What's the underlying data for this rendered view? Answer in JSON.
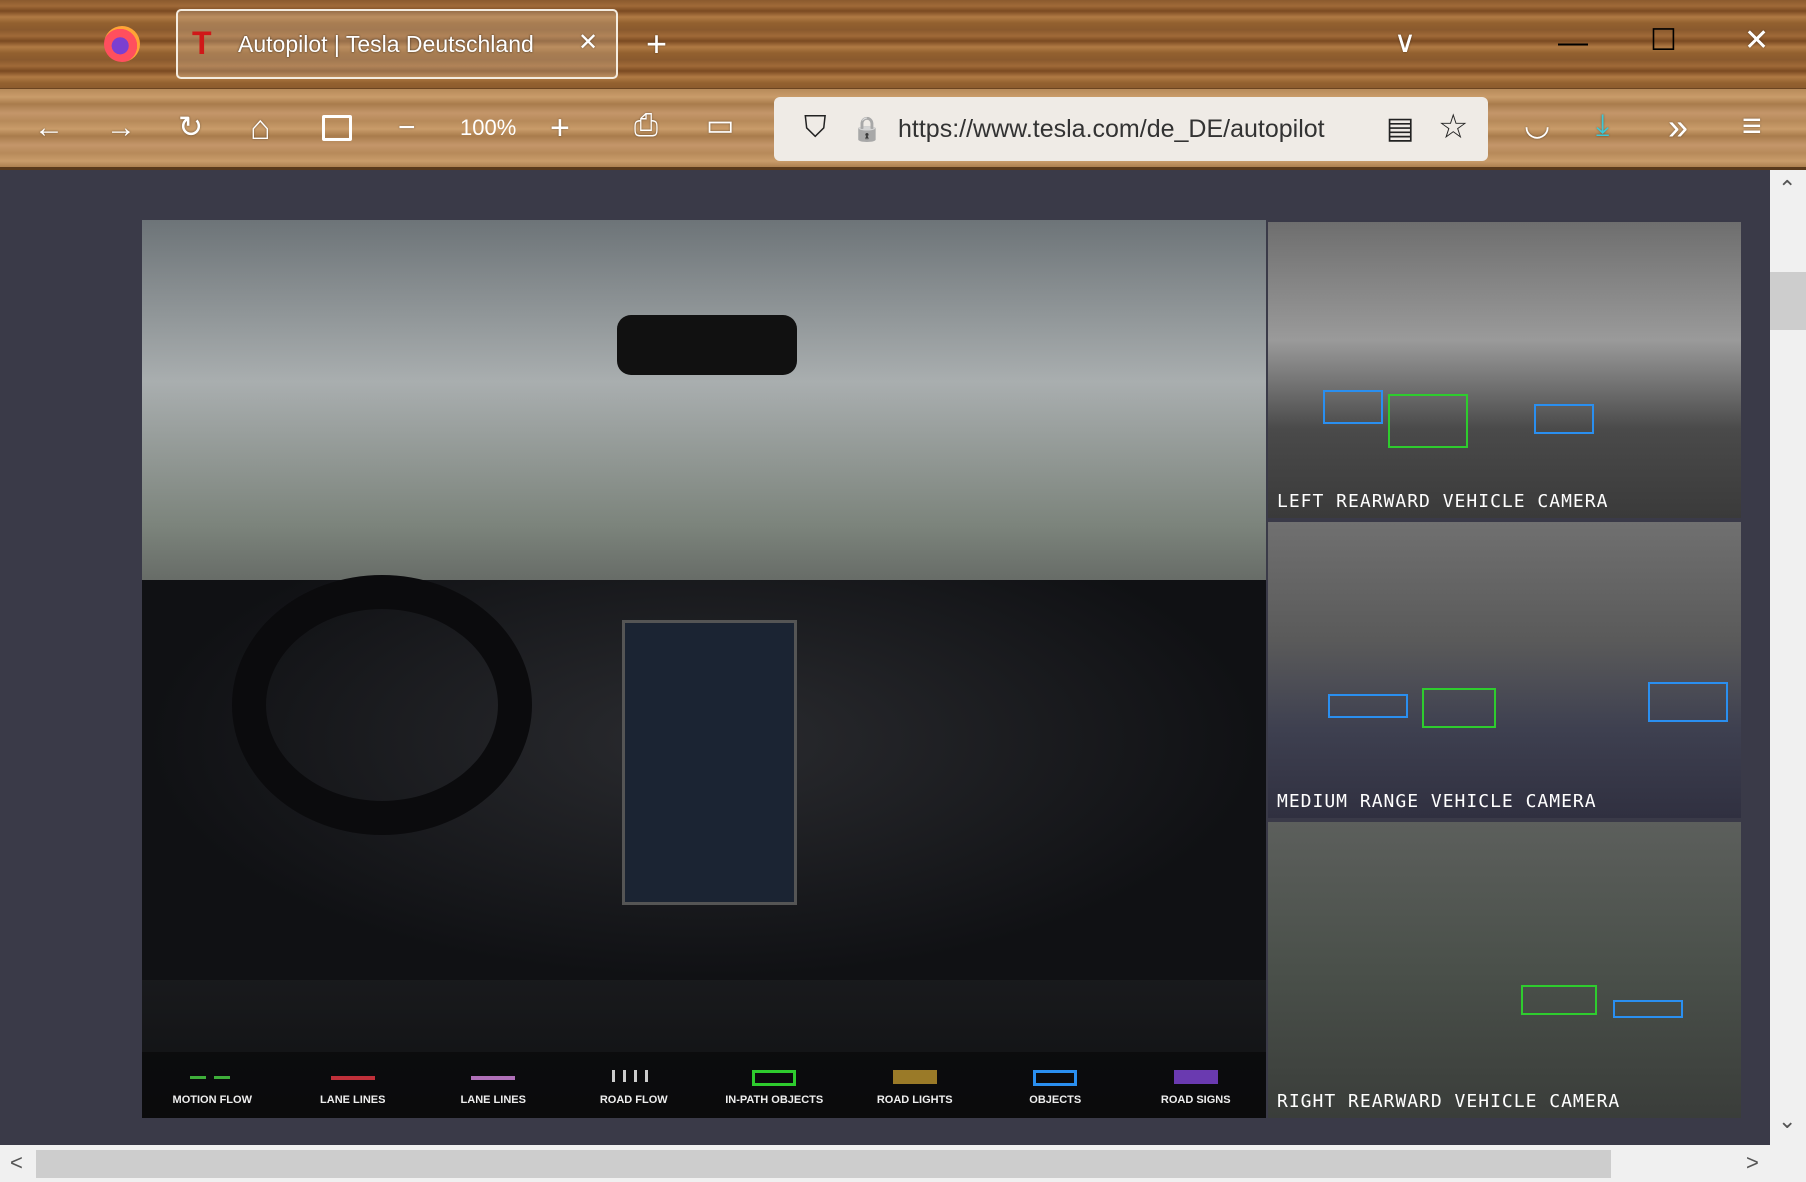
{
  "browser": {
    "tab_title": "Autopilot | Tesla Deutschland",
    "tab_close": "✕",
    "new_tab": "+",
    "tab_list": "∨",
    "window": {
      "minimize": "—",
      "maximize": "☐",
      "close": "✕"
    },
    "toolbar": {
      "back": "←",
      "forward": "→",
      "reload": "↻",
      "home": "⌂",
      "zoom_out": "−",
      "zoom_level": "100%",
      "zoom_in": "+",
      "print": "⎙",
      "screenshot": "▭",
      "pocket": "◡",
      "download": "⤓",
      "overflow": "»",
      "menu": "≡"
    },
    "url": "https://www.tesla.com/de_DE/autopilot",
    "url_icons": {
      "shield": "⛉",
      "lock": "🔒",
      "reader": "▤",
      "star": "☆"
    }
  },
  "main": {
    "legend": [
      {
        "label": "MOTION FLOW",
        "color": "#3fae3a"
      },
      {
        "label": "LANE LINES",
        "color": "#c0303a"
      },
      {
        "label": "LANE LINES",
        "color": "#b070b8"
      },
      {
        "label": "ROAD FLOW",
        "color": "#cccccc"
      },
      {
        "label": "IN-PATH OBJECTS",
        "color": "#2ecc2e"
      },
      {
        "label": "ROAD LIGHTS",
        "color": "#9a7a28"
      },
      {
        "label": "OBJECTS",
        "color": "#2a8ff0"
      },
      {
        "label": "ROAD SIGNS",
        "color": "#6a3ab0"
      }
    ]
  },
  "cameras": [
    {
      "label": "LEFT REARWARD VEHICLE CAMERA"
    },
    {
      "label": "MEDIUM RANGE VEHICLE CAMERA"
    },
    {
      "label": "RIGHT REARWARD VEHICLE CAMERA"
    }
  ],
  "scroll": {
    "up": "⌃",
    "down": "⌄",
    "left": "<",
    "right": ">"
  }
}
